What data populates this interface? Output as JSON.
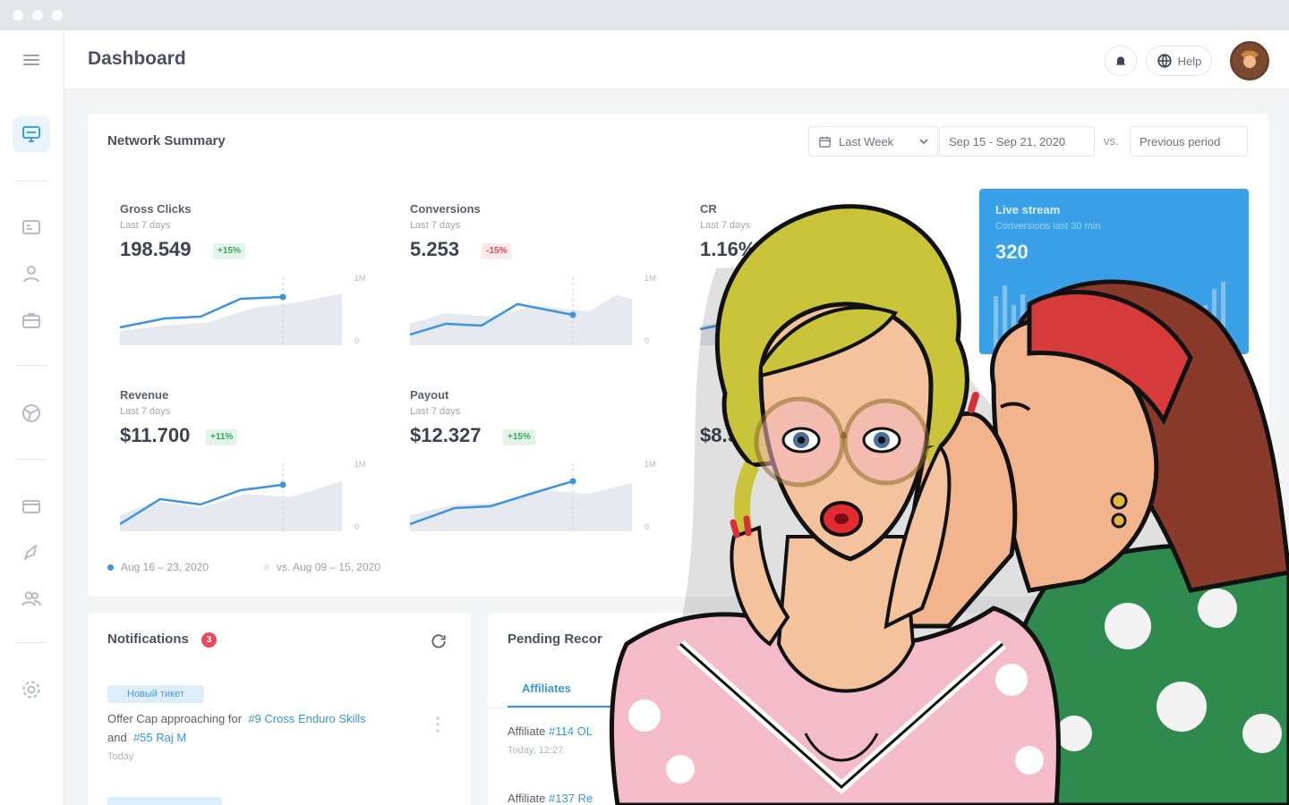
{
  "topbar": {
    "title": "Dashboard",
    "help_label": "Help"
  },
  "summary": {
    "title": "Network Summary",
    "range_label": "Last Week",
    "date_range": "Sep 15 - Sep 21, 2020",
    "vs_label": "vs.",
    "compare_label": "Previous period",
    "metrics": [
      {
        "label": "Gross Clicks",
        "sub": "Last 7 days",
        "value": "198.549",
        "delta": "+15%",
        "trend": "up",
        "axis_top": "1M",
        "axis_bottom": "0"
      },
      {
        "label": "Conversions",
        "sub": "Last 7 days",
        "value": "5.253",
        "delta": "-15%",
        "trend": "down",
        "axis_top": "1M",
        "axis_bottom": "0"
      },
      {
        "label": "CR",
        "sub": "Last 7 days",
        "value": "1.16%"
      },
      {
        "label": "Revenue",
        "sub": "Last 7 days",
        "value": "$11.700",
        "delta": "+11%",
        "trend": "up",
        "axis_top": "1M",
        "axis_bottom": "0"
      },
      {
        "label": "Payout",
        "sub": "Last 7 days",
        "value": "$12.327",
        "delta": "+15%",
        "trend": "up",
        "axis_top": "1M",
        "axis_bottom": "0"
      },
      {
        "value": "$8.5"
      }
    ],
    "legend": {
      "current": "Aug 16 – 23, 2020",
      "previous": "vs. Aug 09 – 15, 2020"
    },
    "colors": {
      "accent": "#3d94dc",
      "area": "#e6e9ef",
      "up": "#34a853",
      "down": "#e34b5a"
    }
  },
  "live": {
    "title": "Live stream",
    "sub": "Conversions last 30 min",
    "value": "320"
  },
  "notifications": {
    "title": "Notifications",
    "count": "3",
    "item": {
      "tag": "Новый тикет",
      "text_prefix": "Offer Cap approaching for",
      "link1": "#9 Cross Enduro Skills",
      "text_mid": "and",
      "link2": "#55 Raj M",
      "time": "Today"
    }
  },
  "pending": {
    "title": "Pending Recor",
    "tab": "Affiliates",
    "rows": [
      {
        "prefix": "Affiliate",
        "link": "#114 OL",
        "time": "Today, 12:27"
      },
      {
        "prefix": "Affiliate",
        "link": "#137 Re"
      }
    ]
  }
}
